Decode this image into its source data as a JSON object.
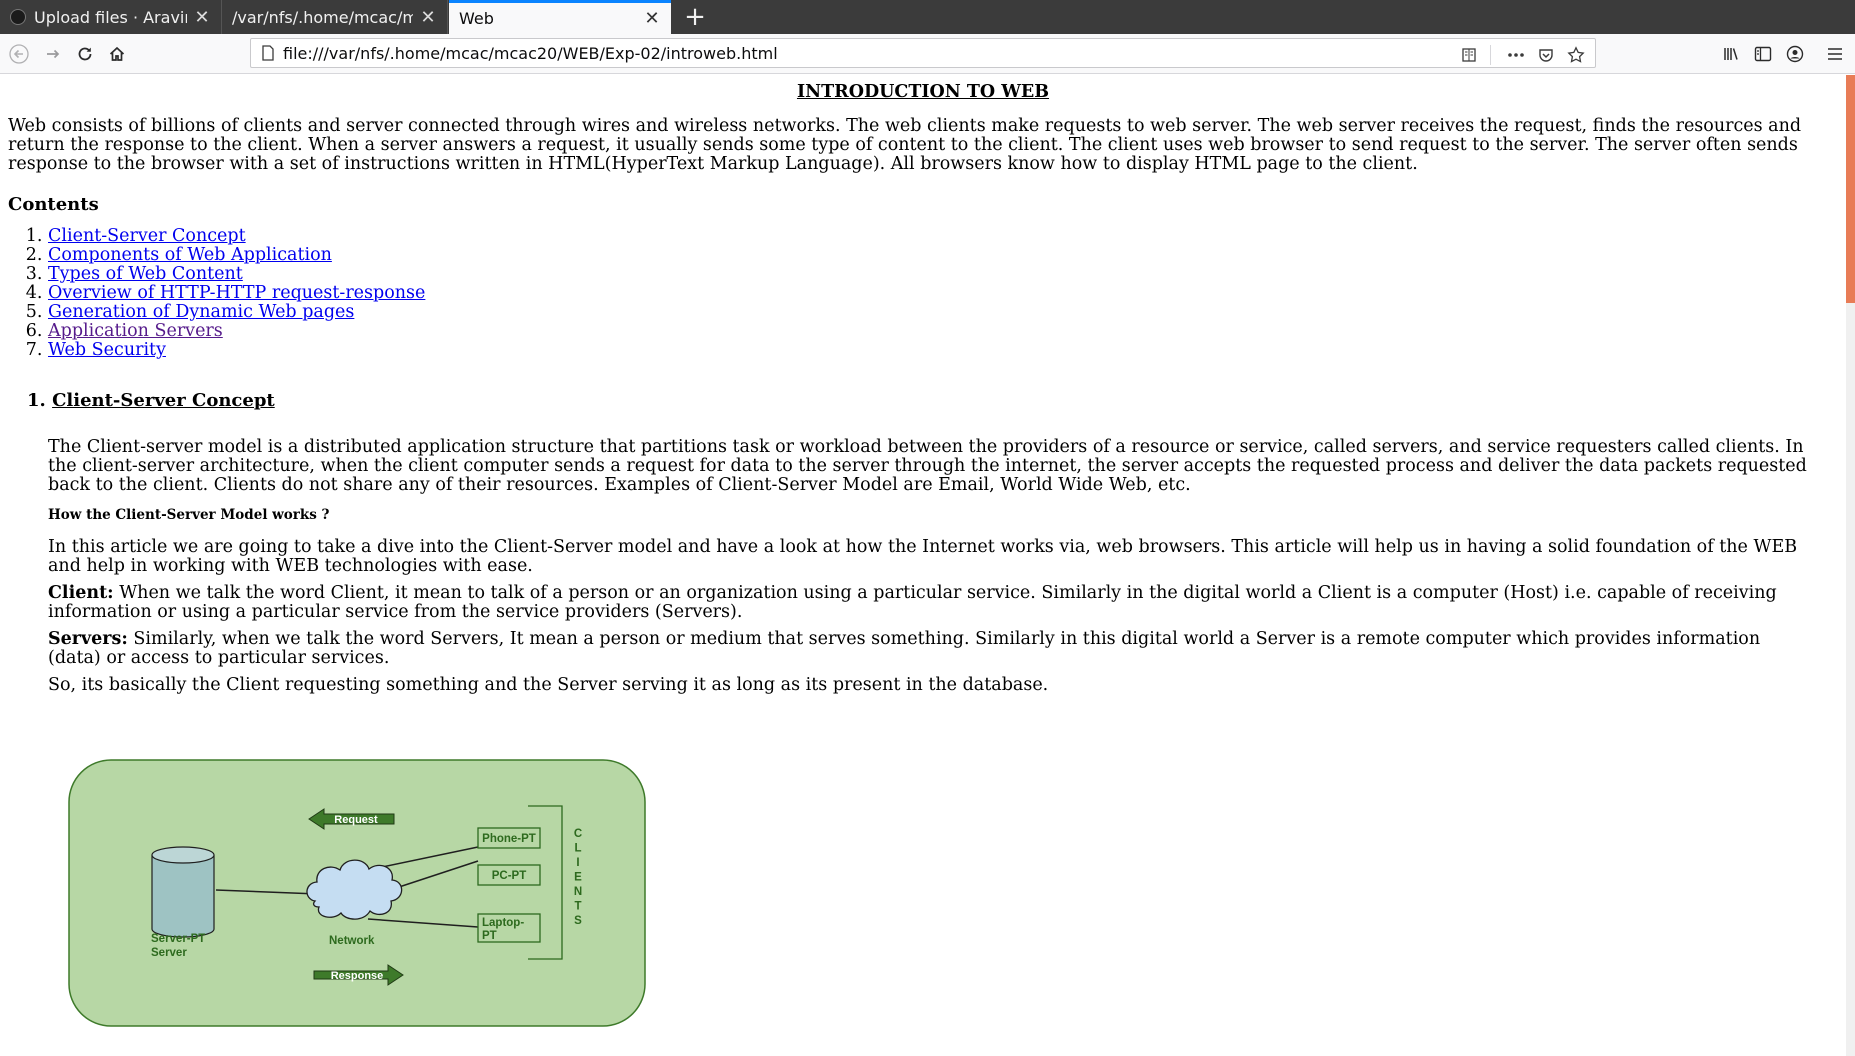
{
  "tabs": [
    {
      "title": "Upload files · AravindKA",
      "active": false
    },
    {
      "title": "/var/nfs/.home/mcac/mcac",
      "active": false
    },
    {
      "title": "Web",
      "active": true
    }
  ],
  "toolbar": {
    "url": "file:///var/nfs/.home/mcac/mcac20/WEB/Exp-02/introweb.html"
  },
  "page": {
    "title": "INTRODUCTION TO WEB",
    "intro": "Web consists of billions of clients and server connected through wires and wireless networks. The web clients make requests to web server. The web server receives the request, finds the resources and return the response to the client. When a server answers a request, it usually sends some type of content to the client. The client uses web browser to send request to the server. The server often sends response to the browser with a set of instructions written in HTML(HyperText Markup Language). All browsers know how to display HTML page to the client.",
    "contents_heading": "Contents",
    "toc": [
      {
        "num": "1.",
        "label": "Client-Server Concept"
      },
      {
        "num": "2.",
        "label": "Components of Web Application"
      },
      {
        "num": "3.",
        "label": "Types of Web Content"
      },
      {
        "num": "4.",
        "label": "Overview of HTTP-HTTP request-response"
      },
      {
        "num": "5.",
        "label": "Generation of Dynamic Web pages"
      },
      {
        "num": "6.",
        "label": "Application Servers"
      },
      {
        "num": "7.",
        "label": "Web Security"
      }
    ],
    "section1": {
      "num": "1.",
      "heading": "Client-Server Concept",
      "p1": "The Client-server model is a distributed application structure that partitions task or workload between the providers of a resource or service, called servers, and service requesters called clients. In the client-server architecture, when the client computer sends a request for data to the server through the internet, the server accepts the requested process and deliver the data packets requested back to the client. Clients do not share any of their resources. Examples of Client-Server Model are Email, World Wide Web, etc.",
      "subheading": "How the Client-Server Model works ?",
      "p2": "In this article we are going to take a dive into the Client-Server model and have a look at how the Internet works via, web browsers. This article will help us in having a solid foundation of the WEB and help in working with WEB technologies with ease.",
      "client_label": "Client:",
      "client_text": " When we talk the word Client, it mean to talk of a person or an organization using a particular service. Similarly in the digital world a Client is a computer (Host) i.e. capable of receiving information or using a particular service from the service providers (Servers).",
      "servers_label": "Servers:",
      "servers_text": " Similarly, when we talk the word Servers, It mean a person or medium that serves something. Similarly in this digital world a Server is a remote computer which provides information (data) or access to particular services.",
      "p3": "So, its basically the Client requesting something and the Server serving it as long as its present in the database."
    },
    "diagram": {
      "request": "Request",
      "response": "Response",
      "server_line1": "Server-PT",
      "server_line2": "Server",
      "network": "Network",
      "phone": "Phone-PT",
      "pc": "PC-PT",
      "laptop_line1": "Laptop-",
      "laptop_line2": "PT",
      "clients_letters": [
        "C",
        "L",
        "I",
        "E",
        "N",
        "T",
        "S"
      ],
      "colors": {
        "panel": "#b7d7a5",
        "arrow": "#3e7a2a",
        "text": "#2d6a1e",
        "cloud": "#c5ddf2",
        "db": "#9ec3c3"
      }
    }
  }
}
